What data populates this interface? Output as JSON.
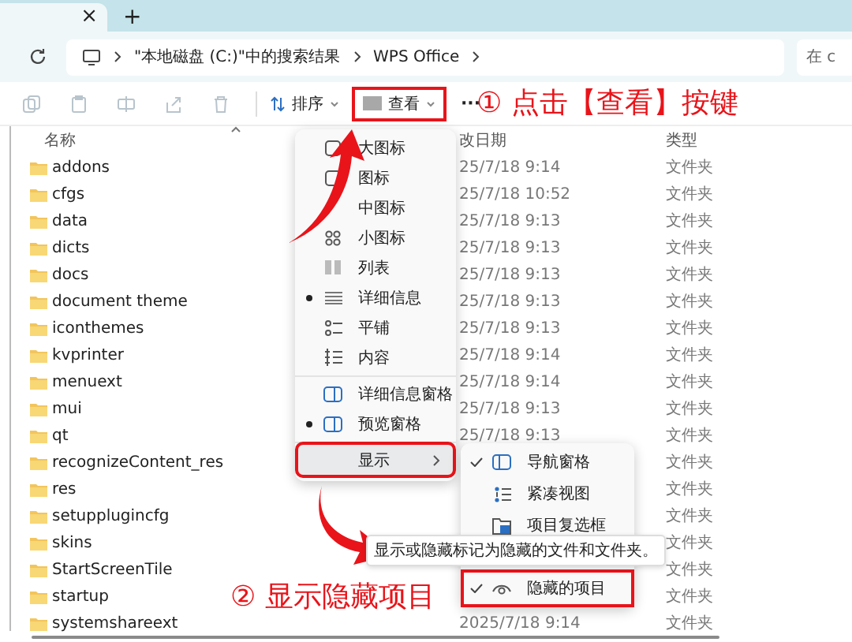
{
  "tab_bar": {
    "close_button": "×",
    "new_tab_button": "+"
  },
  "address_bar": {
    "segments": [
      "\"本地磁盘 (C:)\"中的搜索结果",
      "WPS Office"
    ],
    "search_placeholder": "在 c"
  },
  "toolbar": {
    "actions": [
      {
        "kind": "copy",
        "disabled": true
      },
      {
        "kind": "paste",
        "disabled": true
      },
      {
        "kind": "rename",
        "disabled": true
      },
      {
        "kind": "share",
        "disabled": true
      },
      {
        "kind": "delete",
        "disabled": true
      }
    ],
    "sort_label": "排序",
    "view_button": {
      "label": "查看",
      "outlined": true
    },
    "more_button": "···"
  },
  "table": {
    "columns": [
      "名称",
      "改日期",
      "类型"
    ],
    "rows": [
      {
        "name": "addons",
        "date": "25/7/18 9:14",
        "type": "文件夹"
      },
      {
        "name": "cfgs",
        "date": "25/7/18 10:52",
        "type": "文件夹"
      },
      {
        "name": "data",
        "date": "25/7/18 9:13",
        "type": "文件夹"
      },
      {
        "name": "dicts",
        "date": "25/7/18 9:13",
        "type": "文件夹"
      },
      {
        "name": "docs",
        "date": "25/7/18 9:13",
        "type": "文件夹"
      },
      {
        "name": "document theme",
        "date": "25/7/18 9:13",
        "type": "文件夹"
      },
      {
        "name": "iconthemes",
        "date": "25/7/18 9:13",
        "type": "文件夹"
      },
      {
        "name": "kvprinter",
        "date": "25/7/18 9:14",
        "type": "文件夹"
      },
      {
        "name": "menuext",
        "date": "25/7/18 9:14",
        "type": "文件夹"
      },
      {
        "name": "mui",
        "date": "25/7/18 9:13",
        "type": "文件夹"
      },
      {
        "name": "qt",
        "date": "25/7/18 9:13",
        "type": "文件夹"
      },
      {
        "name": "recognizeContent_res",
        "type": "文件夹"
      },
      {
        "name": "res",
        "type": "文件夹"
      },
      {
        "name": "setupplugincfg",
        "type": "文件夹"
      },
      {
        "name": "skins",
        "type": "文件夹"
      },
      {
        "name": "StartScreenTile",
        "type": "文件夹"
      },
      {
        "name": "startup",
        "type": "文件夹"
      },
      {
        "name": "systemshareext",
        "date": "2025/7/18 9:14",
        "type": "文件夹"
      }
    ]
  },
  "view_menu": {
    "items": [
      {
        "kind": "item",
        "label": "大图标",
        "selected": false
      },
      {
        "kind": "item",
        "label": "图标",
        "selected": false
      },
      {
        "kind": "item",
        "label": "中图标",
        "selected": false
      },
      {
        "kind": "item",
        "label": "小图标",
        "selected": false
      },
      {
        "kind": "item",
        "label": "列表",
        "selected": false
      },
      {
        "kind": "item",
        "label": "详细信息",
        "selected": true
      },
      {
        "kind": "item",
        "label": "平铺",
        "selected": false
      },
      {
        "kind": "item",
        "label": "内容",
        "selected": false
      },
      {
        "kind": "separator"
      },
      {
        "kind": "item",
        "label": "详细信息窗格",
        "selected": false
      },
      {
        "kind": "item",
        "label": "预览窗格",
        "selected": true
      },
      {
        "kind": "separator"
      },
      {
        "kind": "submenu",
        "label": "显示",
        "highlighted": true,
        "outlined": true
      }
    ]
  },
  "show_submenu": {
    "items": [
      {
        "label": "导航窗格",
        "checked": true,
        "outlined": false
      },
      {
        "label": "紧凑视图",
        "checked": false,
        "outlined": false
      },
      {
        "label": "项目复选框",
        "checked": false,
        "outlined": false
      },
      {
        "label": "隐藏的项目",
        "checked": true,
        "outlined": true
      }
    ]
  },
  "tooltip": "显示或隐藏标记为隐藏的文件和文件夹。",
  "annotations": [
    "① 点击【查看】按键",
    "② 显示隐藏项目"
  ]
}
